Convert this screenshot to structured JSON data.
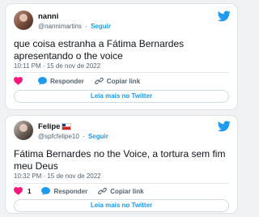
{
  "tweets": [
    {
      "name": "nanni",
      "handle": "@nannimartins",
      "follow_label": "Seguir",
      "text": "que coisa estranha a Fátima Bernardes apresentando o the voice",
      "timestamp": "10:11 PM · 15 de nov de 2022",
      "like_count": "",
      "reply_label": "Responder",
      "copy_label": "Copiar link",
      "read_more_label": "Leia mais no Twitter"
    },
    {
      "name": "Felipe",
      "handle": "@spfcfelipe10",
      "follow_label": "Seguir",
      "text": "Fátima Bernardes no the Voice, a tortura sem fim meu Deus",
      "timestamp": "10:32 PM · 15 de nov de 2022",
      "like_count": "1",
      "reply_label": "Responder",
      "copy_label": "Copiar link",
      "read_more_label": "Leia mais no Twitter"
    }
  ],
  "icons": {
    "brand": "twitter-bird-icon",
    "like": "heart-icon",
    "reply": "speech-bubble-icon",
    "copy": "link-icon",
    "flag": "flag-icon"
  },
  "colors": {
    "accent": "#1d9bf0",
    "like": "#f91880",
    "text": "#0f1419",
    "muted": "#536471",
    "background": "#f0f2f4"
  }
}
